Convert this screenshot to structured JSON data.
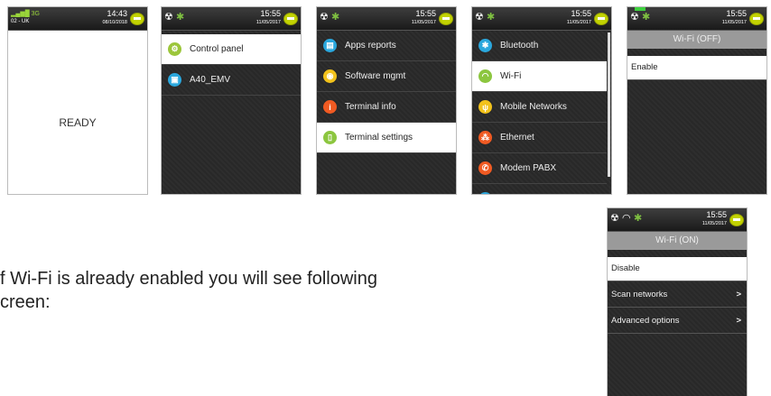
{
  "colors": {
    "battery": "#c2d200",
    "bluetooth": "#7fc041",
    "wifi_green": "#8cc63f",
    "status_bg": "#1f1f1f"
  },
  "screens": {
    "s1": {
      "time": "14:43",
      "date": "08/10/2018",
      "carrier": "02 - UK",
      "network": "3G",
      "body_text": "READY"
    },
    "s2": {
      "time": "15:55",
      "date": "11/05/2017",
      "items": [
        {
          "label": "Control panel",
          "icon": "gears-icon",
          "color": "#9cc63b"
        },
        {
          "label": "A40_EMV",
          "icon": "app-icon",
          "color": "#2aa7dd"
        }
      ]
    },
    "s3": {
      "time": "15:55",
      "date": "11/05/2017",
      "items": [
        {
          "label": "Apps reports",
          "icon": "report-icon",
          "color": "#2aa7dd"
        },
        {
          "label": "Software mgmt",
          "icon": "software-icon",
          "color": "#f2c21b"
        },
        {
          "label": "Terminal info",
          "icon": "info-icon",
          "color": "#f05a22"
        },
        {
          "label": "Terminal settings",
          "icon": "settings-icon",
          "color": "#8cc63f"
        }
      ]
    },
    "s4": {
      "time": "15:55",
      "date": "11/05/2017",
      "items": [
        {
          "label": "Bluetooth",
          "icon": "bluetooth-icon",
          "color": "#2aa7dd"
        },
        {
          "label": "Wi-Fi",
          "icon": "wifi-icon",
          "color": "#8cc63f"
        },
        {
          "label": "Mobile Networks",
          "icon": "antenna-icon",
          "color": "#f2c21b"
        },
        {
          "label": "Ethernet",
          "icon": "ethernet-icon",
          "color": "#f05a22"
        },
        {
          "label": "Modem PABX",
          "icon": "phone-icon",
          "color": "#f05a22"
        },
        {
          "label": "",
          "icon": "network-icon",
          "color": "#2aa7dd"
        }
      ]
    },
    "s5": {
      "time": "15:55",
      "date": "11/05/2017",
      "title": "Wi-Fi (OFF)",
      "options": [
        {
          "label": "Enable"
        }
      ]
    },
    "s6": {
      "time": "15:55",
      "date": "11/05/2017",
      "title": "Wi-Fi (ON)",
      "options": [
        {
          "label": "Disable"
        },
        {
          "label": "Scan networks",
          "arrow": ">"
        },
        {
          "label": "Advanced options",
          "arrow": ">"
        }
      ]
    }
  },
  "caption": {
    "line1": "f Wi-Fi is already enabled you will see following",
    "line2": "creen:"
  }
}
